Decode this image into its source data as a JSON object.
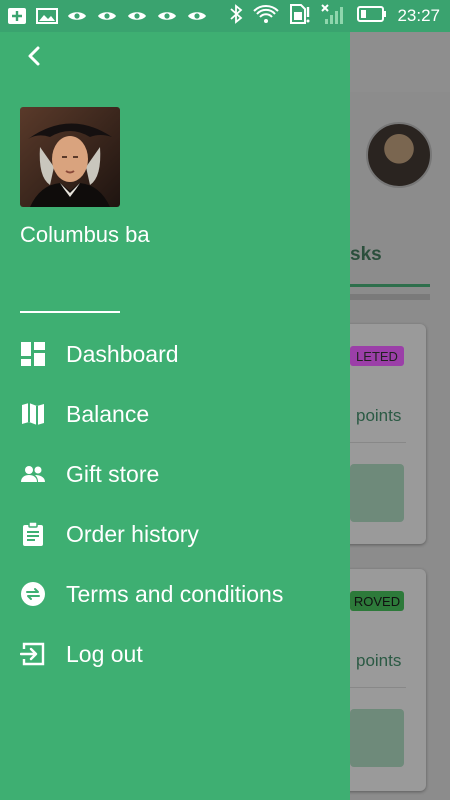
{
  "status_bar": {
    "time": "23:27",
    "icons": [
      "add-box-icon",
      "image-icon",
      "eye-icon",
      "eye-icon",
      "eye-icon",
      "eye-icon",
      "eye-icon",
      "bluetooth-icon",
      "wifi-icon",
      "sim-alert-icon",
      "signal-icon",
      "battery-icon"
    ]
  },
  "drawer": {
    "profile_name": "Columbus ba",
    "menu": [
      {
        "label": "Dashboard",
        "icon": "dashboard-icon"
      },
      {
        "label": "Balance",
        "icon": "map-icon"
      },
      {
        "label": "Gift store",
        "icon": "people-icon"
      },
      {
        "label": "Order history",
        "icon": "clipboard-icon"
      },
      {
        "label": "Terms and conditions",
        "icon": "swap-icon"
      },
      {
        "label": "Log out",
        "icon": "logout-icon"
      }
    ]
  },
  "background": {
    "tab_label_partial": "sks",
    "card1_badge_partial": "LETED",
    "card1_points": "points",
    "card2_badge_partial": "ROVED",
    "card2_points": "points"
  }
}
